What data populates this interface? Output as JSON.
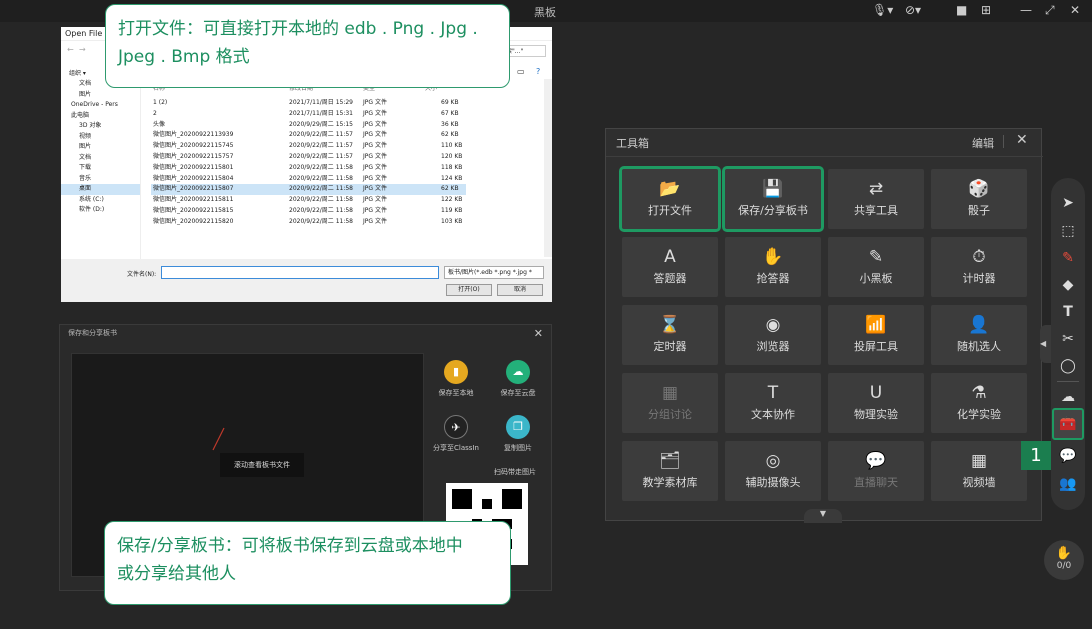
{
  "topbar": {
    "title": "黑板"
  },
  "open_file": {
    "title": "Open File",
    "search_placeholder": "搜索\"...\"",
    "organize": "组织 ▾",
    "sidebar": [
      "文档",
      "图片",
      "OneDrive - Pers",
      "此电脑",
      "3D 对象",
      "视频",
      "图片",
      "文档",
      "下载",
      "音乐",
      "桌面",
      "系统 (C:)",
      "软件 (D:)"
    ],
    "columns": {
      "name": "名称",
      "date": "修改日期",
      "type": "类型",
      "size": "大小"
    },
    "files": [
      {
        "name": "1 (2)",
        "date": "2021/7/11/周日 15:29",
        "type": "JPG 文件",
        "size": "69 KB"
      },
      {
        "name": "2",
        "date": "2021/7/11/周日 15:31",
        "type": "JPG 文件",
        "size": "67 KB"
      },
      {
        "name": "头像",
        "date": "2020/9/29/周二 15:15",
        "type": "JPG 文件",
        "size": "36 KB"
      },
      {
        "name": "微信图片_20200922113939",
        "date": "2020/9/22/周二 11:57",
        "type": "JPG 文件",
        "size": "62 KB"
      },
      {
        "name": "微信图片_20200922115745",
        "date": "2020/9/22/周二 11:57",
        "type": "JPG 文件",
        "size": "110 KB"
      },
      {
        "name": "微信图片_20200922115757",
        "date": "2020/9/22/周二 11:57",
        "type": "JPG 文件",
        "size": "120 KB"
      },
      {
        "name": "微信图片_20200922115801",
        "date": "2020/9/22/周二 11:58",
        "type": "JPG 文件",
        "size": "118 KB"
      },
      {
        "name": "微信图片_20200922115804",
        "date": "2020/9/22/周二 11:58",
        "type": "JPG 文件",
        "size": "124 KB"
      },
      {
        "name": "微信图片_20200922115807",
        "date": "2020/9/22/周二 11:58",
        "type": "JPG 文件",
        "size": "62 KB"
      },
      {
        "name": "微信图片_20200922115811",
        "date": "2020/9/22/周二 11:58",
        "type": "JPG 文件",
        "size": "122 KB"
      },
      {
        "name": "微信图片_20200922115815",
        "date": "2020/9/22/周二 11:58",
        "type": "JPG 文件",
        "size": "119 KB"
      },
      {
        "name": "微信图片_20200922115820",
        "date": "2020/9/22/周二 11:58",
        "type": "JPG 文件",
        "size": "103 KB"
      }
    ],
    "filename_label": "文件名(N):",
    "filename_value": "",
    "filter": "板书/图片(*.edb *.png *.jpg *",
    "open_button": "打开(O)",
    "cancel_button": "取消"
  },
  "callout_top": {
    "line1": "打开文件：可直接打开本地的 edb . Png . Jpg .",
    "line2": "Jpeg . Bmp 格式"
  },
  "callout_bottom": {
    "line1": "保存/分享板书：可将板书保存到云盘或本地中",
    "line2": "或分享给其他人"
  },
  "save_share": {
    "title": "保存和分享板书",
    "scroll_hint": "滚动查看板书文件",
    "options": [
      "保存至本地",
      "保存至云盘",
      "分享至ClassIn",
      "复制图片"
    ],
    "qr_label": "扫码带走图片"
  },
  "toolbox": {
    "title": "工具箱",
    "edit": "编辑",
    "tools": [
      {
        "label": "打开文件",
        "icon": "📂",
        "highlight": true,
        "dim": false
      },
      {
        "label": "保存/分享板书",
        "icon": "💾",
        "highlight": true,
        "dim": false
      },
      {
        "label": "共享工具",
        "icon": "⇄",
        "highlight": false,
        "dim": false
      },
      {
        "label": "骰子",
        "icon": "🎲",
        "highlight": false,
        "dim": false
      },
      {
        "label": "答题器",
        "icon": "A",
        "highlight": false,
        "dim": false
      },
      {
        "label": "抢答器",
        "icon": "✋",
        "highlight": false,
        "dim": false
      },
      {
        "label": "小黑板",
        "icon": "✎",
        "highlight": false,
        "dim": false
      },
      {
        "label": "计时器",
        "icon": "⏱",
        "highlight": false,
        "dim": false
      },
      {
        "label": "定时器",
        "icon": "⌛",
        "highlight": false,
        "dim": false
      },
      {
        "label": "浏览器",
        "icon": "◉",
        "highlight": false,
        "dim": false
      },
      {
        "label": "投屏工具",
        "icon": "📶",
        "highlight": false,
        "dim": false
      },
      {
        "label": "随机选人",
        "icon": "👤",
        "highlight": false,
        "dim": false
      },
      {
        "label": "分组讨论",
        "icon": "▦",
        "highlight": false,
        "dim": true
      },
      {
        "label": "文本协作",
        "icon": "T",
        "highlight": false,
        "dim": false
      },
      {
        "label": "物理实验",
        "icon": "U",
        "highlight": false,
        "dim": false
      },
      {
        "label": "化学实验",
        "icon": "⚗",
        "highlight": false,
        "dim": false
      },
      {
        "label": "教学素材库",
        "icon": "🗂",
        "highlight": false,
        "dim": false
      },
      {
        "label": "辅助摄像头",
        "icon": "◎",
        "highlight": false,
        "dim": false
      },
      {
        "label": "直播聊天",
        "icon": "💬",
        "highlight": false,
        "dim": true
      },
      {
        "label": "视频墙",
        "icon": "▦",
        "highlight": false,
        "dim": false
      }
    ]
  },
  "rail": {
    "badge": "1",
    "hand_count": "0/0"
  }
}
